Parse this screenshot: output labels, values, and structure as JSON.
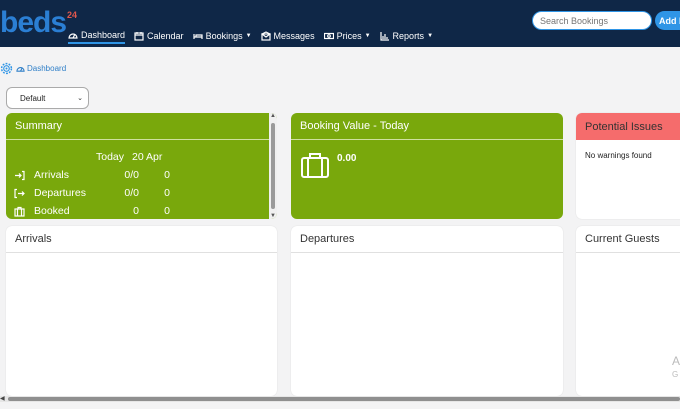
{
  "logo": {
    "text": "beds",
    "suffix": "24"
  },
  "nav": [
    {
      "label": "Dashboard",
      "icon": "dashboard-icon",
      "active": true
    },
    {
      "label": "Calendar",
      "icon": "calendar-icon"
    },
    {
      "label": "Bookings",
      "icon": "bed-icon",
      "dropdown": true
    },
    {
      "label": "Messages",
      "icon": "envelope-icon"
    },
    {
      "label": "Prices",
      "icon": "money-icon",
      "dropdown": true
    },
    {
      "label": "Reports",
      "icon": "chart-icon",
      "dropdown": true
    }
  ],
  "search": {
    "placeholder": "Search Bookings"
  },
  "add_button": "Add B",
  "breadcrumb": {
    "label": "Dashboard"
  },
  "view_select": {
    "value": "Default"
  },
  "summary": {
    "title": "Summary",
    "col1": "Today",
    "col2": "20 Apr",
    "rows": [
      {
        "label": "Arrivals",
        "icon": "sign-in-icon",
        "today": "0/0",
        "date": "0"
      },
      {
        "label": "Departures",
        "icon": "sign-out-icon",
        "today": "0/0",
        "date": "0"
      },
      {
        "label": "Booked",
        "icon": "suitcase-icon",
        "today": "0",
        "date": "0"
      }
    ]
  },
  "booking_value": {
    "title": "Booking Value - Today",
    "value": "0.00"
  },
  "issues": {
    "title": "Potential Issues",
    "text": "No warnings found"
  },
  "arrivals": {
    "title": "Arrivals"
  },
  "departures": {
    "title": "Departures"
  },
  "guests": {
    "title": "Current Guests"
  },
  "watermark": {
    "line1": "A",
    "line2": "G"
  },
  "colors": {
    "topbar": "#0f2747",
    "accent": "#2f95e6",
    "green": "#79a80c",
    "red": "#f56c6c"
  }
}
